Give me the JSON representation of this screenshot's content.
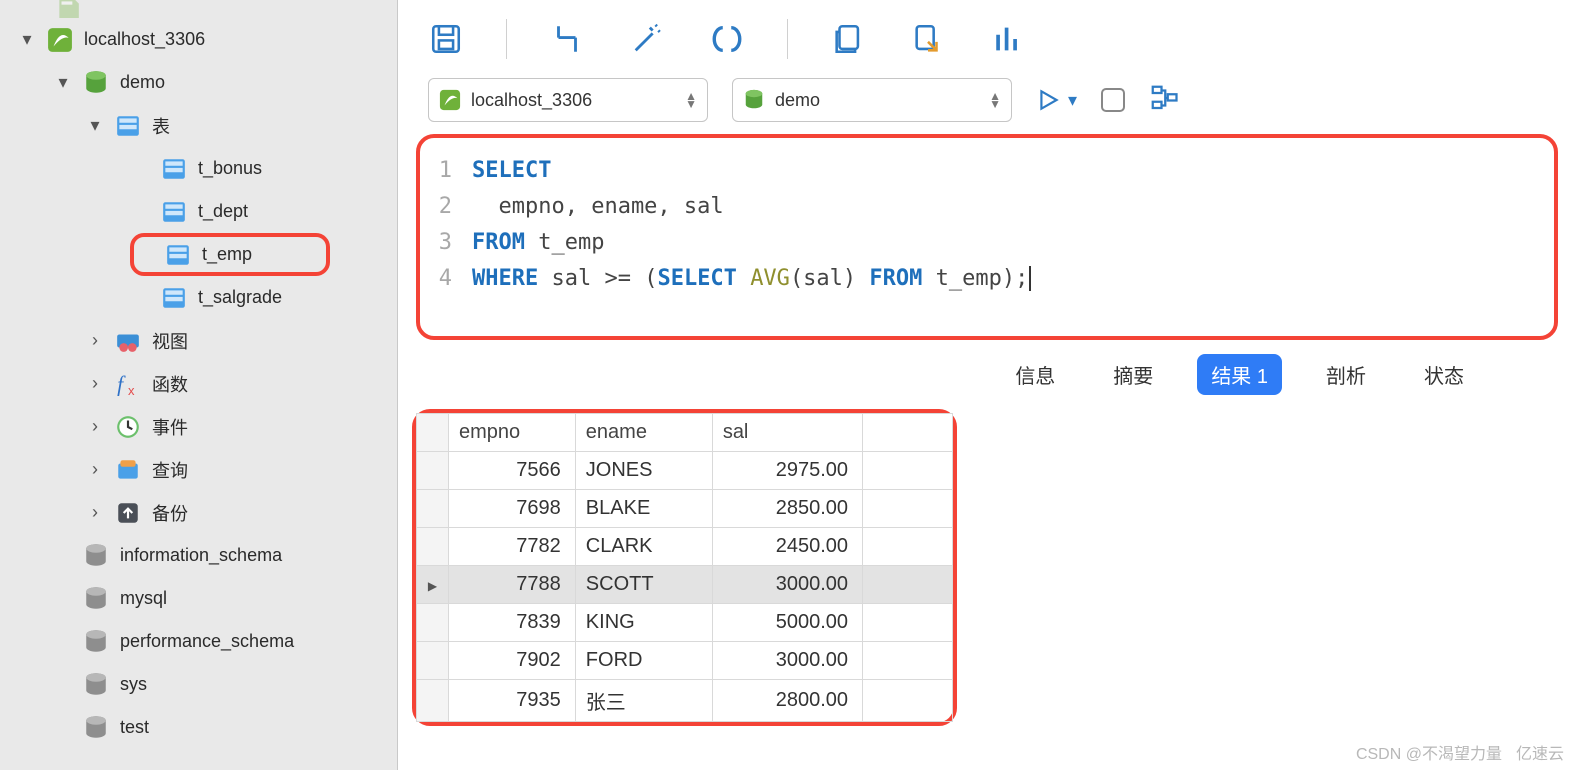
{
  "sidebar": {
    "connection_top": "localhost_3306",
    "database": "demo",
    "tables_node": "表",
    "tables": [
      "t_bonus",
      "t_dept",
      "t_emp",
      "t_salgrade"
    ],
    "selected_table": "t_emp",
    "sections": {
      "views": "视图",
      "functions": "函数",
      "events": "事件",
      "queries": "查询",
      "backups": "备份"
    },
    "system_dbs": [
      "information_schema",
      "mysql",
      "performance_schema",
      "sys",
      "test"
    ]
  },
  "toolbar": {
    "connection": "localhost_3306",
    "database": "demo"
  },
  "sql": {
    "lines": [
      {
        "n": "1",
        "tokens": [
          {
            "t": "kw",
            "v": "SELECT"
          }
        ]
      },
      {
        "n": "2",
        "tokens": [
          {
            "t": "plain",
            "v": "  empno, ename, sal"
          }
        ]
      },
      {
        "n": "3",
        "tokens": [
          {
            "t": "kw",
            "v": "FROM"
          },
          {
            "t": "plain",
            "v": " t_emp"
          }
        ]
      },
      {
        "n": "4",
        "tokens": [
          {
            "t": "kw",
            "v": "WHERE"
          },
          {
            "t": "plain",
            "v": " sal >= ("
          },
          {
            "t": "kw",
            "v": "SELECT"
          },
          {
            "t": "plain",
            "v": " "
          },
          {
            "t": "func",
            "v": "AVG"
          },
          {
            "t": "plain",
            "v": "(sal) "
          },
          {
            "t": "kw",
            "v": "FROM"
          },
          {
            "t": "plain",
            "v": " t_emp);"
          }
        ]
      }
    ]
  },
  "result_tabs": {
    "info": "信息",
    "summary": "摘要",
    "result": "结果 1",
    "profile": "剖析",
    "status": "状态"
  },
  "results": {
    "columns": [
      "empno",
      "ename",
      "sal"
    ],
    "rows": [
      {
        "empno": "7566",
        "ename": "JONES",
        "sal": "2975.00"
      },
      {
        "empno": "7698",
        "ename": "BLAKE",
        "sal": "2850.00"
      },
      {
        "empno": "7782",
        "ename": "CLARK",
        "sal": "2450.00"
      },
      {
        "empno": "7788",
        "ename": "SCOTT",
        "sal": "3000.00"
      },
      {
        "empno": "7839",
        "ename": "KING",
        "sal": "5000.00"
      },
      {
        "empno": "7902",
        "ename": "FORD",
        "sal": "3000.00"
      },
      {
        "empno": "7935",
        "ename": "张三",
        "sal": "2800.00"
      }
    ],
    "active_row_index": 3
  },
  "watermark": {
    "left": "CSDN @不渴望力量",
    "right": "亿速云"
  }
}
